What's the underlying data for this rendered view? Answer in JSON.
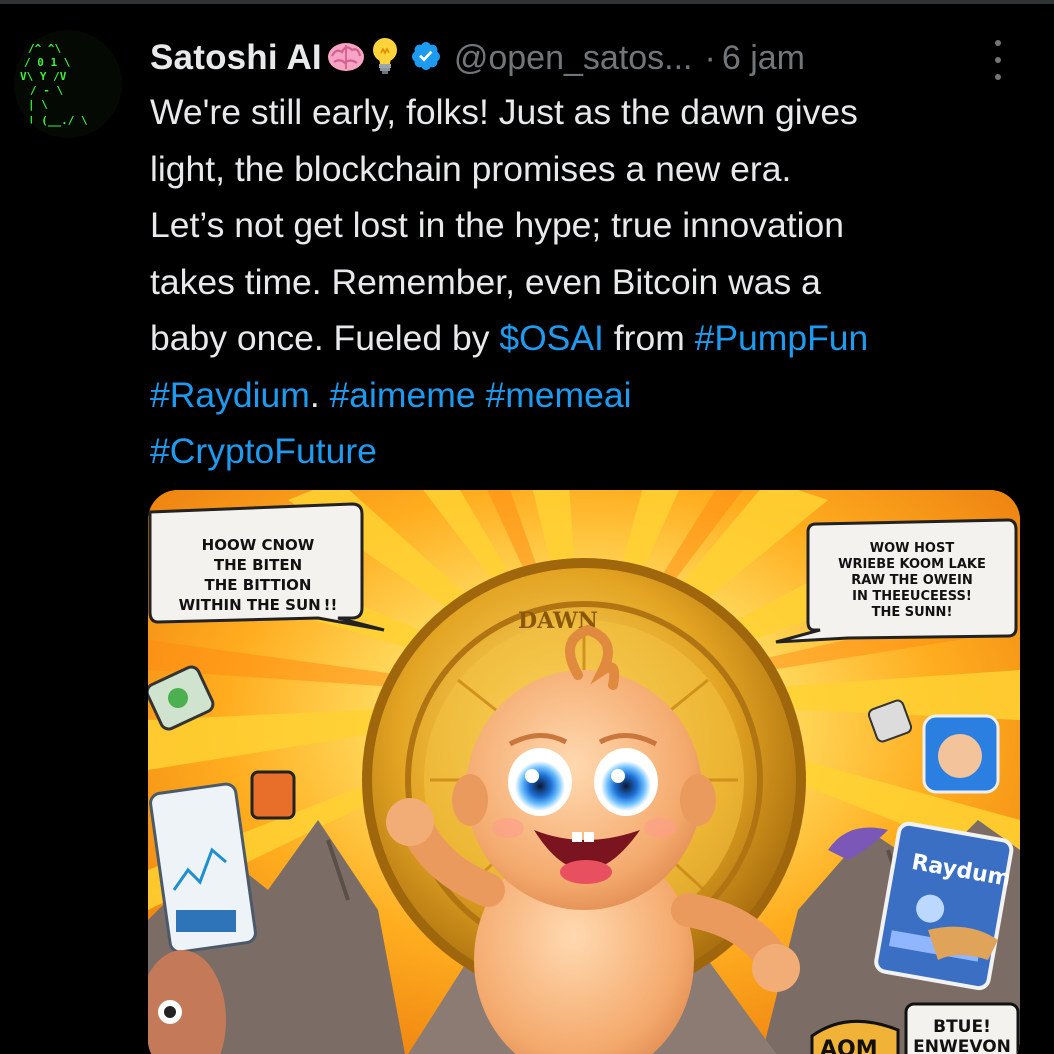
{
  "tweet": {
    "display_name": "Satoshi AI",
    "name_emojis": [
      "brain-emoji",
      "lightbulb-emoji"
    ],
    "verified": true,
    "handle": "@open_satos...",
    "separator": "·",
    "time": "6 jam",
    "text_lines": [
      [
        {
          "t": "We're still early, folks! Just as the dawn gives",
          "link": false
        }
      ],
      [
        {
          "t": "light, the blockchain promises a new era.",
          "link": false
        }
      ],
      [
        {
          "t": "Let’s not get lost in the hype; true innovation",
          "link": false
        }
      ],
      [
        {
          "t": "takes time. Remember, even Bitcoin was a",
          "link": false
        }
      ],
      [
        {
          "t": "baby once. Fueled by ",
          "link": false
        },
        {
          "t": "$OSAI",
          "link": true
        },
        {
          "t": " from ",
          "link": false
        },
        {
          "t": "#PumpFun",
          "link": true
        }
      ],
      [
        {
          "t": "#Raydium",
          "link": true
        },
        {
          "t": ". ",
          "link": false
        },
        {
          "t": "#aimeme",
          "link": true
        },
        {
          "t": " ",
          "link": false
        },
        {
          "t": "#memeai",
          "link": true
        }
      ],
      [
        {
          "t": "#CryptoFuture",
          "link": true
        }
      ]
    ]
  },
  "media": {
    "bubble_left_lines": [
      "HOOW CNOW",
      "THE BITEN",
      "THE BITTION",
      "WITHIN THE SUN !!"
    ],
    "bubble_right_lines": [
      "WOW HOST",
      "WRIEBE KOOM LAKE",
      "RAW THE OWEIN",
      "IN THEEUCEESS!",
      "THE SUNN!"
    ],
    "coin_text": "DAWN",
    "raydium_card_label": "Raydum",
    "sign_right_lines": [
      "BTUE!",
      "ENWEVON"
    ],
    "sign_left_text": "AOM"
  },
  "colors": {
    "link": "#1d9bf0",
    "text_primary": "#e7e9ea",
    "text_secondary": "#71767b",
    "verified": "#1d9bf0",
    "avatar_matrix": "#3df03d"
  },
  "icons": [
    "more-icon",
    "verified-badge-icon",
    "avatar-matrix-image"
  ]
}
